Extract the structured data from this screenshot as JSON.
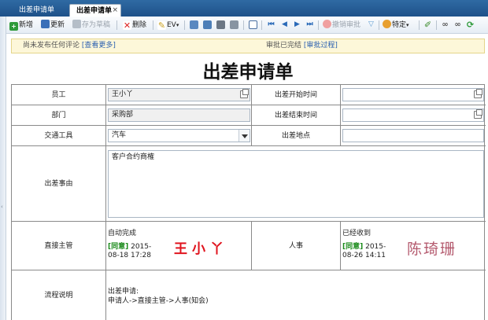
{
  "tabs": [
    {
      "label": "出差申请单",
      "active": false
    },
    {
      "label": "出差申请单",
      "active": true,
      "close": "×"
    }
  ],
  "toolbar": {
    "new": "新增",
    "update": "更新",
    "save_draft": "存为草稿",
    "delete": "删除",
    "ev": "EV",
    "revoke": "撤销审批",
    "specific": "特定"
  },
  "notice": {
    "comments_text": "尚未发布任何评论",
    "comments_link": "[查看更多]",
    "approval_text": "审批已完结",
    "approval_link": "[审批过程]"
  },
  "form": {
    "title": "出差申请单",
    "employee_label": "员工",
    "employee_value": "王小丫",
    "start_label": "出差开始时间",
    "start_value": "",
    "dept_label": "部门",
    "dept_value": "采购部",
    "end_label": "出差结束时间",
    "end_value": "",
    "transport_label": "交通工具",
    "transport_value": "汽车",
    "place_label": "出差地点",
    "place_value": "",
    "reason_label": "出差事由",
    "reason_value": "客户合约商榷",
    "supervisor_label": "直接主管",
    "supervisor_status": "自动完成",
    "supervisor_tag": "[同意]",
    "supervisor_time_a": "2015-",
    "supervisor_time_b": "08-18 17:28",
    "supervisor_signature": "王小丫",
    "hr_label": "人事",
    "hr_status": "已经收到",
    "hr_tag": "[同意]",
    "hr_time_a": "2015-",
    "hr_time_b": "08-26 14:11",
    "hr_signature": "陈琦珊",
    "flow_label": "流程说明",
    "flow_line1": "出差申请:",
    "flow_line2": "申请人->直接主管->人事(知会)"
  },
  "colors": {
    "approve_green": "#1a8a1a",
    "signature_red": "#e0141e",
    "signature_pink": "#b45a6e",
    "link_blue": "#2a5fb0",
    "tab_blue": "#2f6aa3"
  }
}
